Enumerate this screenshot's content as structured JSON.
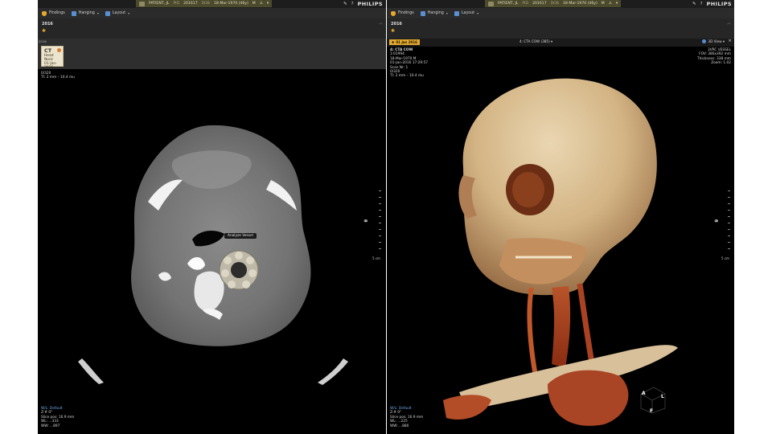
{
  "header": {
    "patient_name": "PATIENT, JL",
    "pid_label": "PID",
    "pid_value": "201617",
    "dob_label": "DOB",
    "dob_value": "18-Mar-1970 (46y)",
    "sex": "M",
    "brand": "PHILIPS"
  },
  "toolbar": {
    "findings_label": "Findings",
    "hanging_label": "Hanging",
    "layout_label": "Layout"
  },
  "timeline": {
    "year": "2016"
  },
  "study": {
    "strip_tag": "2016",
    "modality": "CT",
    "body_part": "Head Neck",
    "date": "01-Jan-2016"
  },
  "left_viewport": {
    "top_left": [
      "0/320",
      "TI: 2 mm – 10.4 mu"
    ],
    "bottom_left": {
      "wl_label": "W/L: Default",
      "lines": [
        "Z:# 0°",
        "Slice pos: 16.9 mm",
        "WL: ...333",
        "WW: ...897"
      ]
    },
    "scale_label": "5 cm"
  },
  "radial_menu": {
    "title": "Analyze Vessel"
  },
  "right_viewport": {
    "date_tag": "01 Jan 2016",
    "dataset_label": "4: CTA COW (385) ▾",
    "view_label": "3D View ▾",
    "close_glyph": "×",
    "top_left": [
      "4: CTA COW",
      "1:01994",
      "18-Mar-1970 M",
      "01-Jan-2016 17:29:57",
      "Scan Nr: 1",
      "0/320",
      "TI: 2 mm – 10.4 mu"
    ],
    "top_right": [
      "3VRC VESSEL",
      "FOV: 380x392 mm",
      "Thickness: 338 mm",
      "Zoom: 1.02"
    ],
    "bottom_left": {
      "wl_label": "W/L: Default",
      "lines": [
        "Z:# 0°",
        "Slice pos: 16.9 mm",
        "WL: ...225",
        "WW: ...880"
      ]
    },
    "scale_label": "5 cm",
    "orientation": [
      "A",
      "L",
      "F"
    ]
  },
  "colors": {
    "accent": "#e4a92e",
    "wl_blue": "#6fa8e6",
    "patient_strip": "#4b4a2c"
  }
}
